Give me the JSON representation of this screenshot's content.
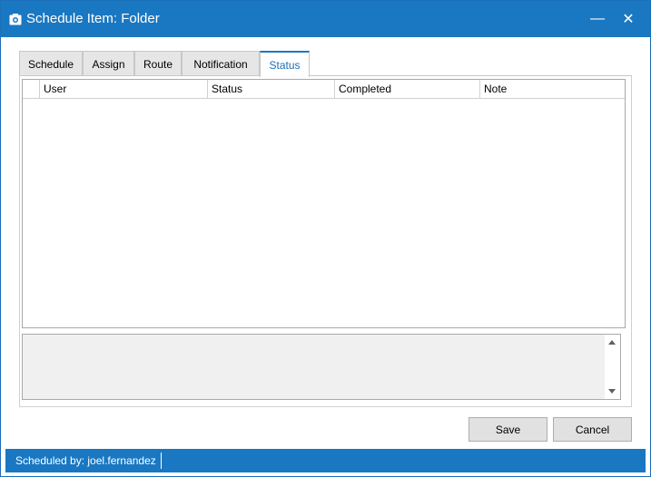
{
  "window": {
    "title": "Schedule Item: Folder",
    "title_icon": "camera-icon",
    "minimize_glyph": "—",
    "close_glyph": "✕"
  },
  "tabs": [
    {
      "label": "Schedule",
      "active": false
    },
    {
      "label": "Assign",
      "active": false
    },
    {
      "label": "Route",
      "active": false
    },
    {
      "label": "Notification",
      "active": false
    },
    {
      "label": "Status",
      "active": true
    }
  ],
  "grid": {
    "columns": [
      "",
      "User",
      "Status",
      "Completed",
      "Note"
    ],
    "rows": []
  },
  "note_box": {
    "value": ""
  },
  "buttons": {
    "save": "Save",
    "cancel": "Cancel"
  },
  "status_bar": {
    "text": "Scheduled by: joel.fernandez"
  },
  "colors": {
    "accent": "#1a78c2",
    "active_tab_text": "#1a6fb8"
  }
}
